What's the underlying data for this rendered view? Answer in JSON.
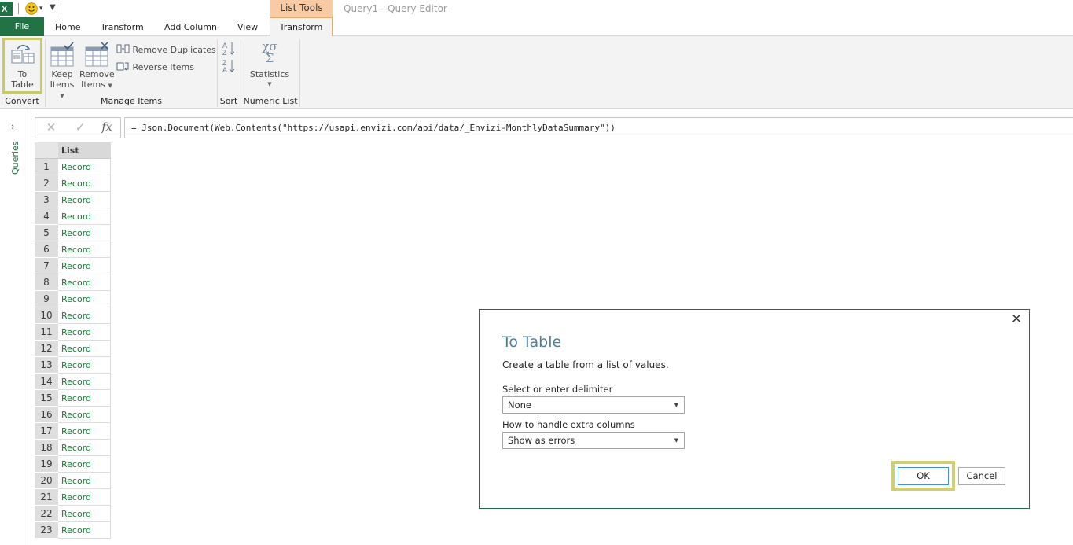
{
  "titlebar": {
    "context_tab": "List Tools",
    "window_title": "Query1 - Query Editor"
  },
  "tabs": {
    "file": "File",
    "items": [
      "Home",
      "Transform",
      "Add Column",
      "View"
    ],
    "active": "Transform"
  },
  "ribbon": {
    "convert": {
      "button_line1": "To",
      "button_line2": "Table",
      "group_label": "Convert"
    },
    "manage": {
      "keep_line1": "Keep",
      "keep_line2": "Items",
      "remove_line1": "Remove",
      "remove_line2": "Items",
      "remove_duplicates": "Remove Duplicates",
      "reverse_items": "Reverse Items",
      "group_label": "Manage Items"
    },
    "sort": {
      "group_label": "Sort"
    },
    "numeric": {
      "statistics": "Statistics",
      "group_label": "Numeric List"
    }
  },
  "queries_rail": {
    "label": "Queries"
  },
  "formula_bar": {
    "formula": "= Json.Document(Web.Contents(\"https://usapi.envizi.com/api/data/_Envizi-MonthlyDataSummary\"))"
  },
  "grid": {
    "column_header": "List",
    "rows": [
      {
        "n": "1",
        "v": "Record"
      },
      {
        "n": "2",
        "v": "Record"
      },
      {
        "n": "3",
        "v": "Record"
      },
      {
        "n": "4",
        "v": "Record"
      },
      {
        "n": "5",
        "v": "Record"
      },
      {
        "n": "6",
        "v": "Record"
      },
      {
        "n": "7",
        "v": "Record"
      },
      {
        "n": "8",
        "v": "Record"
      },
      {
        "n": "9",
        "v": "Record"
      },
      {
        "n": "10",
        "v": "Record"
      },
      {
        "n": "11",
        "v": "Record"
      },
      {
        "n": "12",
        "v": "Record"
      },
      {
        "n": "13",
        "v": "Record"
      },
      {
        "n": "14",
        "v": "Record"
      },
      {
        "n": "15",
        "v": "Record"
      },
      {
        "n": "16",
        "v": "Record"
      },
      {
        "n": "17",
        "v": "Record"
      },
      {
        "n": "18",
        "v": "Record"
      },
      {
        "n": "19",
        "v": "Record"
      },
      {
        "n": "20",
        "v": "Record"
      },
      {
        "n": "21",
        "v": "Record"
      },
      {
        "n": "22",
        "v": "Record"
      },
      {
        "n": "23",
        "v": "Record"
      }
    ]
  },
  "dialog": {
    "title": "To Table",
    "description": "Create a table from a list of values.",
    "delimiter_label": "Select or enter delimiter",
    "delimiter_value": "None",
    "extra_columns_label": "How to handle extra columns",
    "extra_columns_value": "Show as errors",
    "ok": "OK",
    "cancel": "Cancel"
  },
  "colors": {
    "excel_green": "#217346",
    "context_tab_orange": "#f8cba4",
    "highlight": "#c9c96a",
    "dialog_title": "#4d7f95",
    "record_link": "#1b7a3a"
  }
}
